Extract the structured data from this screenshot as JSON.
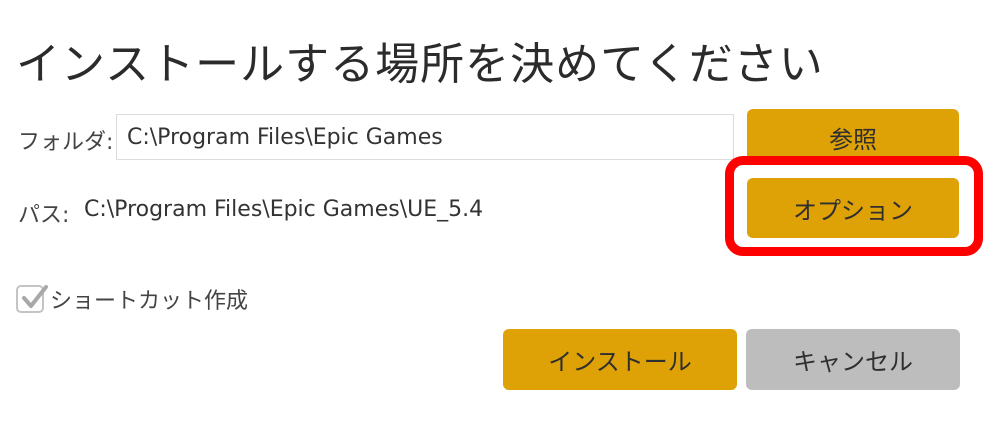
{
  "dialog": {
    "title": "インストールする場所を決めてください",
    "folder_label": "フォルダ:",
    "folder_value": "C:\\Program Files\\Epic Games",
    "browse_label": "参照",
    "path_label": "パス:",
    "path_value": "C:\\Program Files\\Epic Games\\UE_5.4",
    "options_label": "オプション",
    "shortcut_label": "ショートカット作成",
    "shortcut_checked": true,
    "install_label": "インストール",
    "cancel_label": "キャンセル"
  },
  "colors": {
    "primary_button": "#dea106",
    "secondary_button": "#bdbdbd",
    "highlight": "#ff0000"
  },
  "icons": {
    "checkbox": "checkmark-icon"
  }
}
